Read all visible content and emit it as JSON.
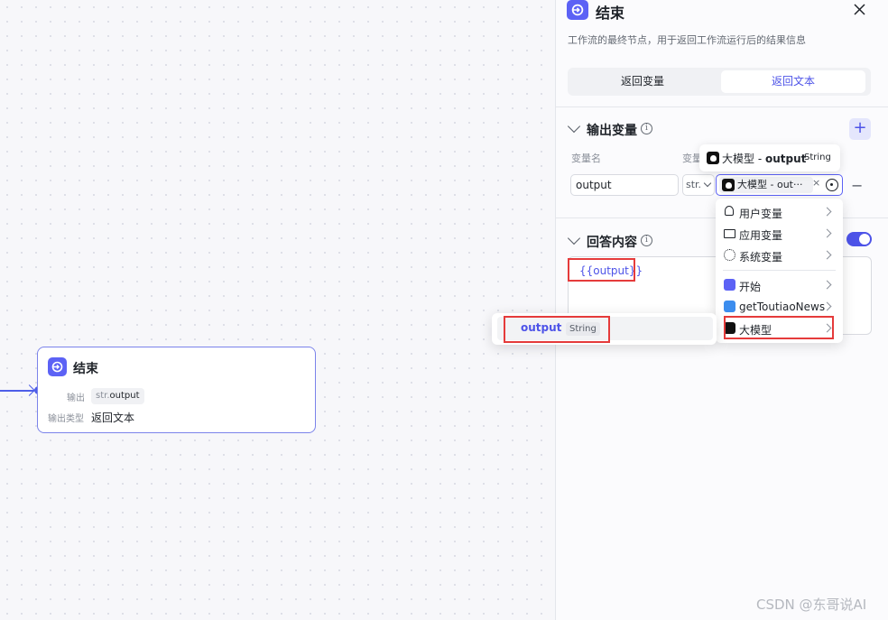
{
  "canvas": {
    "node": {
      "title": "结束",
      "output_label": "输出",
      "output_tag_prefix": "str.",
      "output_tag_name": "output",
      "output_type_label": "输出类型",
      "output_type_value": "返回文本"
    }
  },
  "panel": {
    "title": "结束",
    "description": "工作流的最终节点，用于返回工作流运行后的结果信息",
    "tabs": [
      "返回变量",
      "返回文本"
    ],
    "active_tab": "返回文本",
    "output_section": {
      "title": "输出变量",
      "info": "i",
      "add": "+",
      "col_name": "变量名",
      "col_value": "变量",
      "name_value": "output",
      "type_value": "str.",
      "ref_value": "大模型 - out···",
      "ref_clear": "×",
      "remove": "−"
    },
    "answer_section": {
      "title": "回答内容",
      "info": "i",
      "toggle_on": true,
      "content": "{{output}}"
    }
  },
  "tooltip": {
    "source": "大模型 - ",
    "var": "output",
    "type": "String"
  },
  "menu": {
    "items": [
      {
        "label": "用户变量",
        "icon": "user-icon"
      },
      {
        "label": "应用变量",
        "icon": "folder-icon"
      },
      {
        "label": "系统变量",
        "icon": "gear-icon"
      },
      {
        "label": "开始",
        "icon": "start-node-icon"
      },
      {
        "label": "getToutiaoNews",
        "icon": "plugin-icon"
      },
      {
        "label": "大模型",
        "icon": "model-icon"
      }
    ]
  },
  "submenu": {
    "name": "output",
    "type": "String"
  },
  "colors": {
    "accent": "#4d53e8",
    "highlight": "#e53b3b"
  },
  "watermark": "CSDN @东哥说AI"
}
